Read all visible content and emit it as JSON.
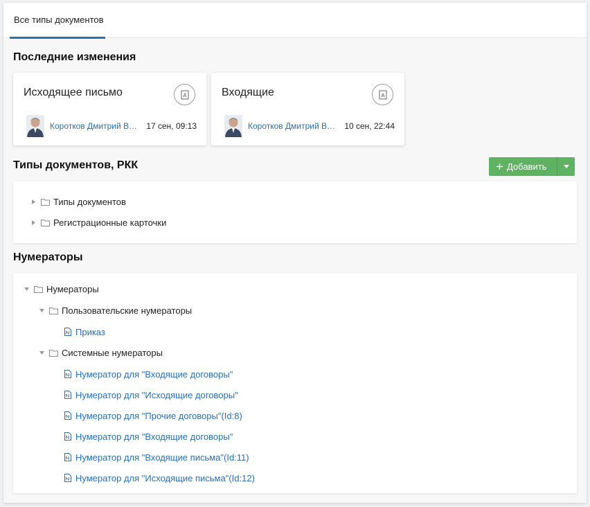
{
  "tabs": [
    {
      "label": "Все типы документов"
    }
  ],
  "recent": {
    "title": "Последние изменения",
    "cards": [
      {
        "title": "Исходящее письмо",
        "author": "Коротков Дмитрий Викторович",
        "date": "17 сен, 09:13"
      },
      {
        "title": "Входящие",
        "author": "Коротков Дмитрий Викторович",
        "date": "10 сен, 22:44"
      }
    ]
  },
  "doc_types": {
    "title": "Типы документов, РКК",
    "add_label": "Добавить",
    "items": [
      {
        "label": "Типы документов"
      },
      {
        "label": "Регистрационные карточки"
      }
    ]
  },
  "numerators": {
    "title": "Нумераторы",
    "root": "Нумераторы",
    "user_group": "Пользовательские нумераторы",
    "user_items": [
      "Приказ"
    ],
    "system_group": "Системные нумераторы",
    "system_items": [
      "Нумератор для \"Входящие договоры\"",
      "Нумератор для \"Исходящие договоры\"",
      "Нумератор для \"Прочие договоры\"(Id:8)",
      "Нумератор для \"Входящие договоры\"",
      "Нумератор для \"Входящие письма\"(Id:11)",
      "Нумератор для \"Исходящие письма\"(Id:12)"
    ]
  },
  "colors": {
    "accent": "#2a6fb0",
    "add_button": "#5fb262"
  }
}
